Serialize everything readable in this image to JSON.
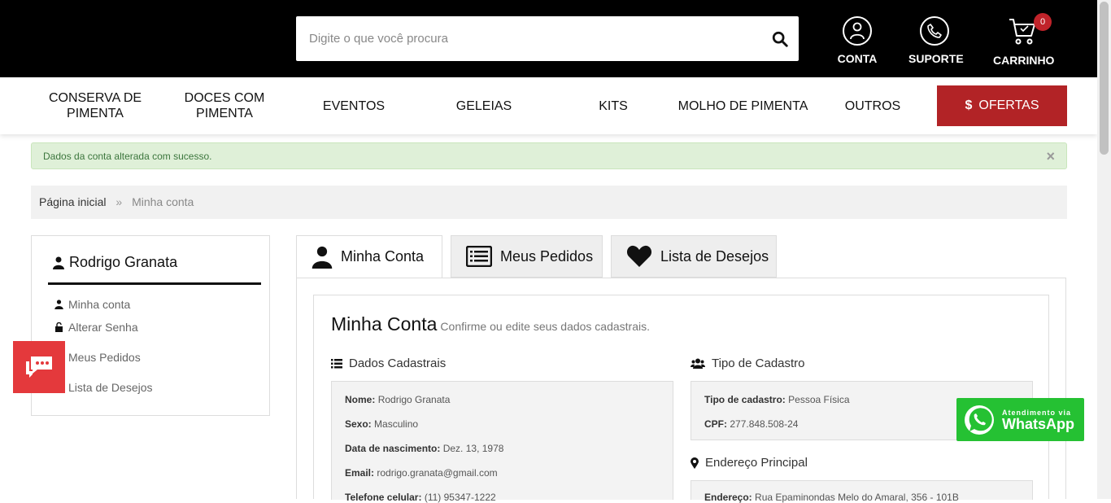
{
  "search": {
    "placeholder": "Digite o que você procura"
  },
  "header": {
    "account_label": "CONTA",
    "support_label": "SUPORTE",
    "cart_label": "CARRINHO",
    "cart_count": "0"
  },
  "nav": {
    "items": [
      {
        "line1": "CONSERVA DE",
        "line2": "PIMENTA"
      },
      {
        "line1": "DOCES COM",
        "line2": "PIMENTA"
      },
      {
        "line1": "EVENTOS",
        "line2": ""
      },
      {
        "line1": "GELEIAS",
        "line2": ""
      },
      {
        "line1": "KITS",
        "line2": ""
      },
      {
        "line1": "MOLHO DE PIMENTA",
        "line2": ""
      },
      {
        "line1": "OUTROS",
        "line2": ""
      }
    ],
    "offer_label": "OFERTAS",
    "offer_color": "#b22326"
  },
  "alert": {
    "text": "Dados da conta alterada com sucesso.",
    "close": "×"
  },
  "breadcrumb": {
    "home": "Página inicial",
    "sep": "»",
    "current": "Minha conta"
  },
  "sidebar": {
    "user_name": "Rodrigo Granata",
    "links": [
      "Minha conta",
      "Alterar Senha",
      "Meus Pedidos",
      "Lista de Desejos"
    ]
  },
  "tabs": [
    "Minha Conta",
    "Meus Pedidos",
    "Lista de Desejos"
  ],
  "account": {
    "title": "Minha Conta",
    "subtitle": "Confirme ou edite seus dados cadastrais.",
    "personal_heading": "Dados Cadastrais",
    "personal": [
      {
        "label": "Nome:",
        "value": "Rodrigo Granata"
      },
      {
        "label": "Sexo:",
        "value": "Masculino"
      },
      {
        "label": "Data de nascimento:",
        "value": "Dez. 13, 1978"
      },
      {
        "label": "Email:",
        "value": "rodrigo.granata@gmail.com"
      },
      {
        "label": "Telefone celular:",
        "value": "(11) 95347-1222"
      }
    ],
    "type_heading": "Tipo de Cadastro",
    "type": [
      {
        "label": "Tipo de cadastro:",
        "value": "Pessoa Física"
      },
      {
        "label": "CPF:",
        "value": "277.848.508-24"
      }
    ],
    "address_heading": "Endereço Principal",
    "address": {
      "label": "Endereço:",
      "value": "Rua Epaminondas Melo do Amaral, 356 - 101B"
    }
  },
  "whatsapp": {
    "line1": "Atendimento via",
    "line2": "WhatsApp",
    "color": "#25c133"
  }
}
